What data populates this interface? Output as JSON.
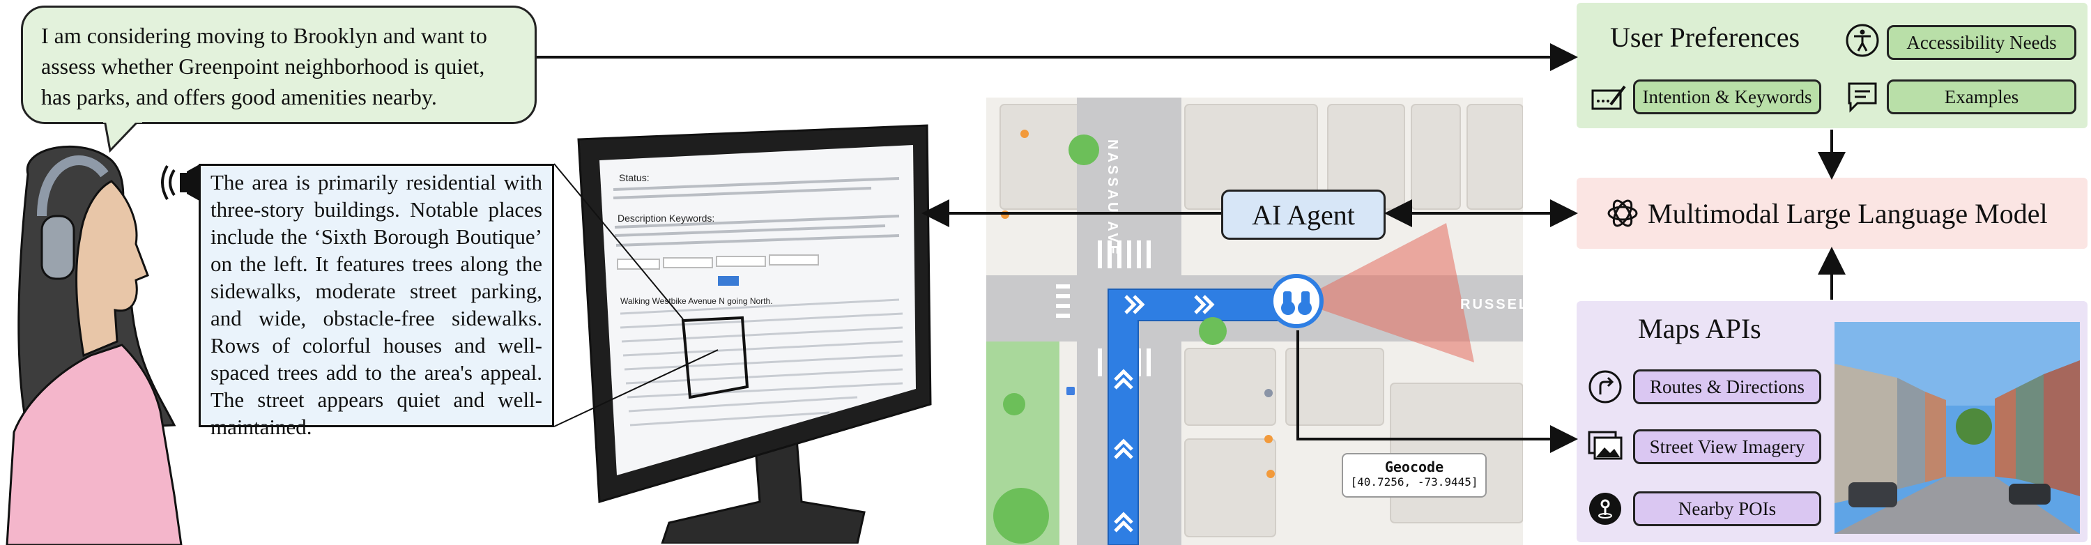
{
  "query_bubble": {
    "text": "I am considering moving to Brooklyn and want to assess whether Greenpoint neighborhood is quiet, has parks, and offers good amenities nearby."
  },
  "description": {
    "text": "The area is primarily residential with three-story buildings. Notable places include the ‘Sixth Borough Boutique’ on the left. It features trees along the sidewalks, moderate street parking, and wide, obstacle-free sidewalks. Rows of colorful houses and well-spaced trees add to the area's appeal. The street appears quiet and well-maintained."
  },
  "screen": {
    "status_heading": "Status:",
    "keywords_heading": "Description Keywords:",
    "walking_heading": "Walking Westbike Avenue N going North."
  },
  "ai_agent": {
    "label": "AI Agent"
  },
  "map": {
    "street_label_vertical": "NASSAU AVE",
    "street_label_right": "RUSSELL"
  },
  "geocode": {
    "title": "Geocode",
    "coords": "[40.7256, -73.9445]"
  },
  "user_preferences": {
    "title": "User Preferences",
    "items": {
      "accessibility": "Accessibility Needs",
      "intention": "Intention & Keywords",
      "examples": "Examples"
    }
  },
  "llm": {
    "label": "Multimodal Large Language Model"
  },
  "maps_apis": {
    "title": "Maps APIs",
    "items": {
      "routes": "Routes & Directions",
      "street_view": "Street View Imagery",
      "pois": "Nearby POIs"
    }
  },
  "colors": {
    "bubble_green": "#e3f2dc",
    "desc_blue": "#eaf3fb",
    "pref_panel": "#dcefd3",
    "llm_panel": "#fbe5e3",
    "maps_panel": "#ebe3f6",
    "route_blue": "#2e7ee3"
  }
}
